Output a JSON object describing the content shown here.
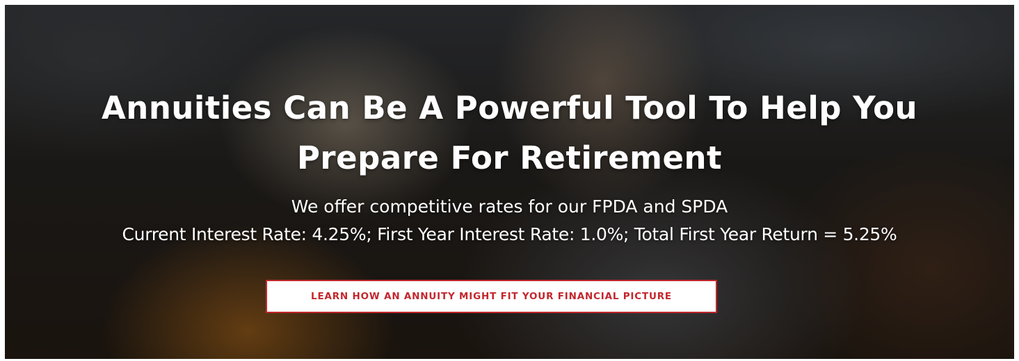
{
  "hero": {
    "headline_line1": "Annuities Can Be A Powerful Tool To Help You",
    "headline_line2": "Prepare For Retirement",
    "subtext_line1": "We offer competitive rates for our FPDA and SPDA",
    "subtext_line2": "Current Interest Rate: 4.25%; First Year Interest Rate: 1.0%; Total First Year Return = 5.25%",
    "cta_label": "LEARN HOW AN ANNUITY MIGHT FIT YOUR FINANCIAL PICTURE"
  },
  "colors": {
    "accent": "#c2272d",
    "text": "#ffffff"
  }
}
